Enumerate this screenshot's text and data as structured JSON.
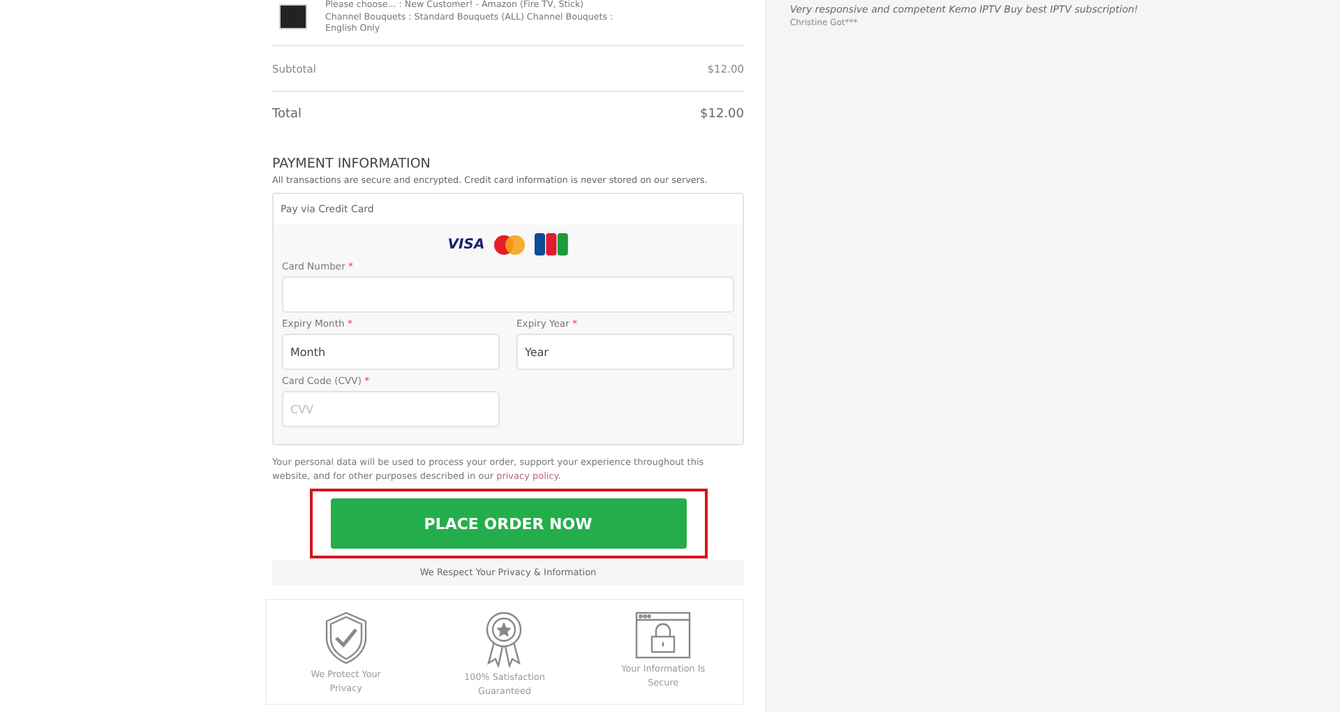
{
  "order_item": {
    "options": [
      "Please choose... : New Customer! - Amazon (Fire TV, Stick)",
      "Channel Bouquets : Standard Bouquets (ALL) Channel Bouquets :",
      "English Only"
    ]
  },
  "totals": [
    {
      "kind": "subtotal",
      "label": "Subtotal",
      "amount": "$12.00"
    },
    {
      "kind": "total",
      "label": "Total",
      "amount": "$12.00"
    }
  ],
  "payment": {
    "heading": "PAYMENT INFORMATION",
    "note": "All transactions are secure and encrypted. Credit card information is never stored on our servers.",
    "method": "Pay via Credit Card",
    "visa_logo": "VISA",
    "fields": [
      {
        "label": "Card Number",
        "required": "*",
        "kind": "wide"
      },
      {
        "label": "Expiry Month",
        "required": "*",
        "value": "Month",
        "kind": "narrow"
      },
      {
        "label": "Expiry Year",
        "required": "*",
        "value": "Year",
        "kind": "narrow"
      },
      {
        "label": "Card Code (CVV)",
        "required": "*",
        "placeholder": "CVV",
        "kind": "narrow"
      }
    ]
  },
  "consent": {
    "text": "Your personal data will be used to process your order, support your experience throughout this website, and for other purposes described in our",
    "link": "privacy policy",
    "end": "."
  },
  "order_button": "PLACE ORDER NOW",
  "privacy_bar": "We Respect Your Privacy & Information",
  "badges": [
    {
      "kind": "shield",
      "label": "We Protect Your Privacy"
    },
    {
      "kind": "ribbon",
      "label": "100% Satisfaction Guaranteed"
    },
    {
      "kind": "lock",
      "label": "Your Information Is Secure"
    }
  ],
  "testimonial": {
    "quote": "Very responsive and competent Kemo IPTV Buy best IPTV subscription!",
    "author": "Christine Got***"
  }
}
